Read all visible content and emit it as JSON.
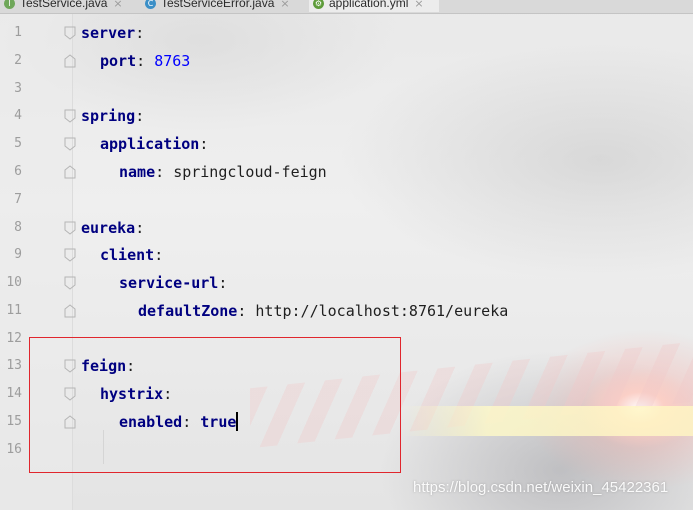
{
  "tabs": [
    {
      "label": "TestService.java",
      "icon": "java-interface-icon",
      "icon_color": "#6fa75a",
      "active": false
    },
    {
      "label": "TestServiceError.java",
      "icon": "java-class-icon",
      "icon_color": "#3b8fc7",
      "active": false
    },
    {
      "label": "application.yml",
      "icon": "yaml-config-icon",
      "icon_color": "#5e9c3a",
      "active": true
    }
  ],
  "tab_close_glyph": "×",
  "line_numbers": [
    "1",
    "2",
    "3",
    "4",
    "5",
    "6",
    "7",
    "8",
    "9",
    "10",
    "11",
    "12",
    "13",
    "14",
    "15",
    "16"
  ],
  "code": {
    "l1_key": "server",
    "l2_key": "port",
    "l2_value": "8763",
    "l4_key": "spring",
    "l5_key": "application",
    "l6_key": "name",
    "l6_value": "springcloud-feign",
    "l8_key": "eureka",
    "l9_key": "client",
    "l10_key": "service-url",
    "l11_key": "defaultZone",
    "l11_value": "http://localhost:8761/eureka",
    "l13_key": "feign",
    "l14_key": "hystrix",
    "l15_key": "enabled",
    "l15_value": "true",
    "colon": ":"
  },
  "watermark": "https://blog.csdn.net/weixin_45422361",
  "colors": {
    "key": "#000080",
    "number": "#0000ff",
    "annotation_box": "#e0262d"
  }
}
